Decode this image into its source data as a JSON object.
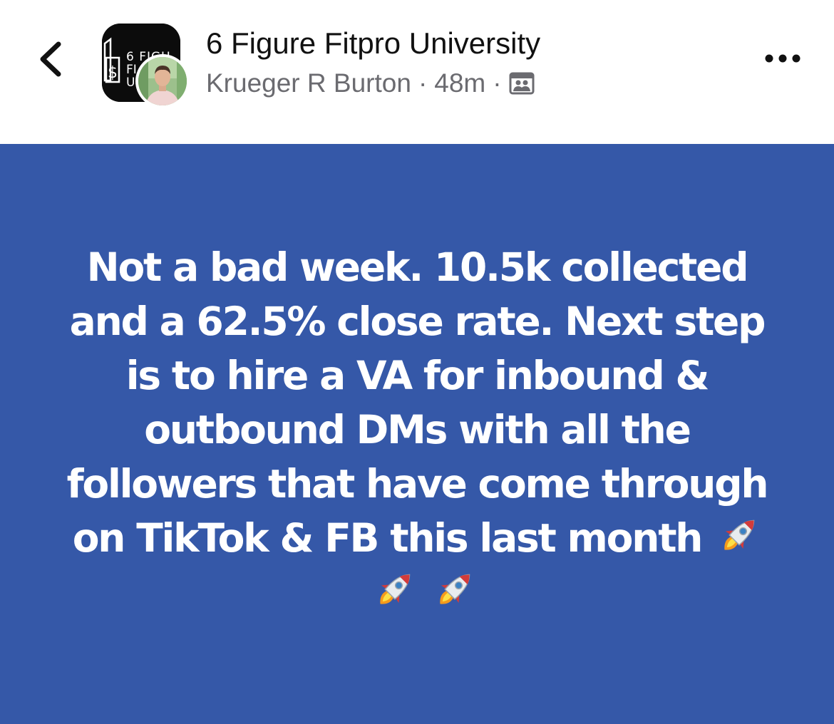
{
  "header": {
    "group_name": "6 Figure Fitpro University",
    "author": "Krueger R Burton",
    "time": "48m",
    "separator": "·",
    "group_avatar_text": [
      "6 FIGU",
      "FI",
      "U"
    ],
    "icons": {
      "back": "chevron-left-icon",
      "privacy": "group-audience-icon",
      "more": "more-horizontal-icon"
    }
  },
  "post": {
    "background_color": "#3558a8",
    "text": "Not a bad week. 10.5k collected and a 62.5% close rate. Next step is to hire a VA for inbound & outbound DMs with all the followers that have come through on TikTok & FB this last month",
    "emojis": [
      "rocket",
      "rocket",
      "rocket"
    ]
  }
}
